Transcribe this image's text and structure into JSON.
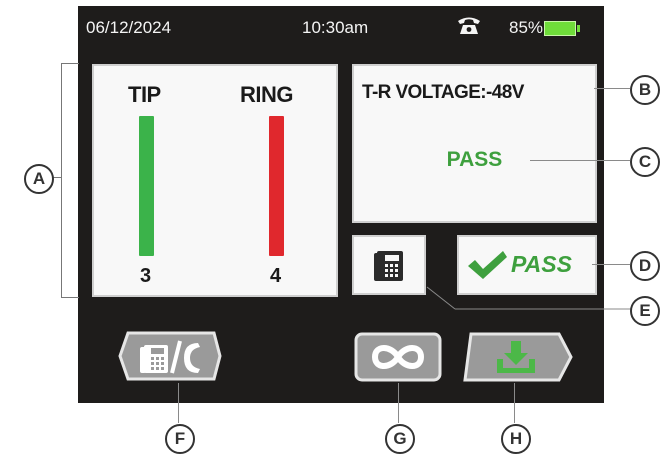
{
  "status_bar": {
    "date": "06/12/2024",
    "time": "10:30am",
    "phone_icon": "telephone-icon",
    "battery_percent": "85%",
    "battery_level": 0.85,
    "battery_color": "#6fdd3a"
  },
  "tip_ring_panel": {
    "tip_label": "TIP",
    "ring_label": "RING",
    "tip_value": "3",
    "ring_value": "4",
    "tip_color": "#3bb34a",
    "ring_color": "#e0282d"
  },
  "voltage_panel": {
    "voltage_text": "T-R VOLTAGE:-48V",
    "result": "PASS"
  },
  "dial_test_button": {
    "icon": "desk-phone-icon"
  },
  "pass_button": {
    "icon": "checkmark-icon",
    "label": "PASS"
  },
  "bottom_buttons": {
    "phone_call_icon": "phone-call-icon",
    "loop_icon": "infinity-icon",
    "save_icon": "download-icon"
  },
  "callouts": {
    "a": "A",
    "b": "B",
    "c": "C",
    "d": "D",
    "e": "E",
    "f": "F",
    "g": "G",
    "h": "H"
  },
  "colors": {
    "screen_bg": "#1e1c1b",
    "pass_green": "#3ea03e",
    "tab_gray": "#9a9a9a"
  }
}
